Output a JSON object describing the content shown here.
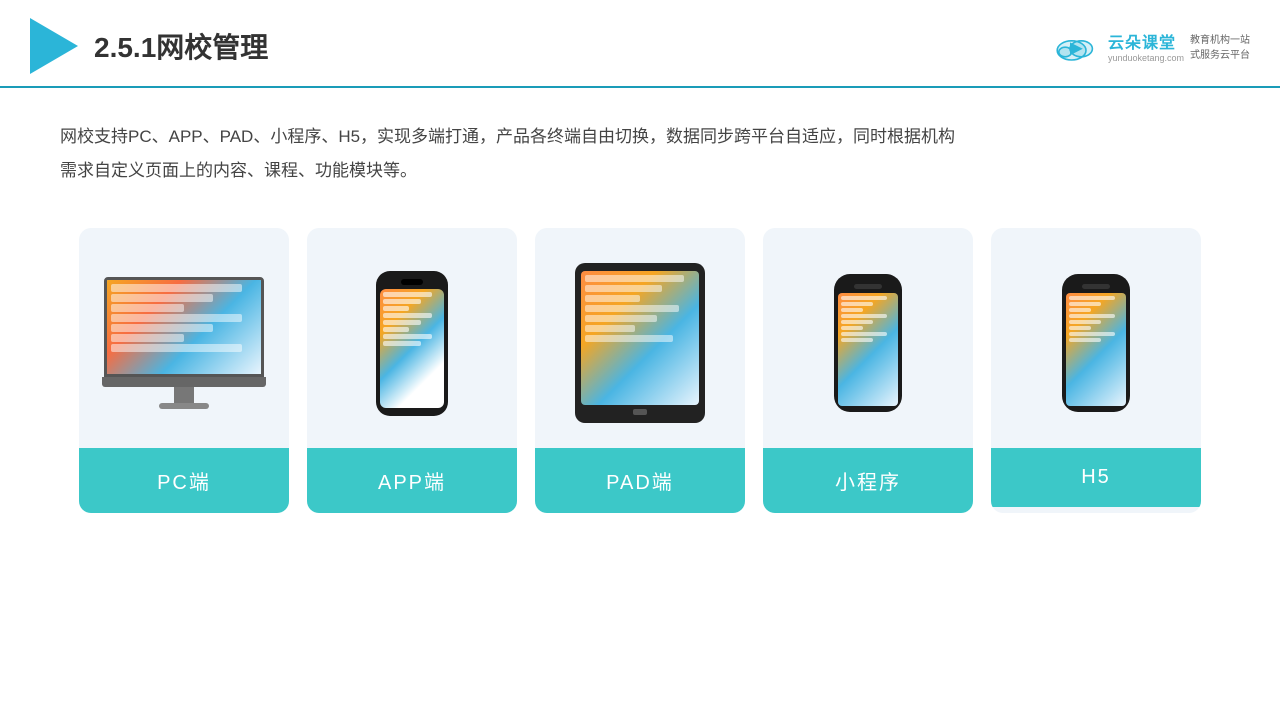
{
  "header": {
    "title": "2.5.1网校管理",
    "brand": {
      "name": "云朵课堂",
      "url": "yunduoketang.com",
      "tagline": "教育机构一站\n式服务云平台"
    }
  },
  "description": {
    "text": "网校支持PC、APP、PAD、小程序、H5，实现多端打通，产品各终端自由切换，数据同步跨平台自适应，同时根据机构需求自定义页面上的内容、课程、功能模块等。"
  },
  "cards": [
    {
      "id": "pc",
      "label": "PC端"
    },
    {
      "id": "app",
      "label": "APP端"
    },
    {
      "id": "pad",
      "label": "PAD端"
    },
    {
      "id": "mini",
      "label": "小程序"
    },
    {
      "id": "h5",
      "label": "H5"
    }
  ],
  "colors": {
    "accent": "#3cc8c8",
    "header_border": "#1a9cb8",
    "title": "#333333",
    "description": "#444444"
  }
}
